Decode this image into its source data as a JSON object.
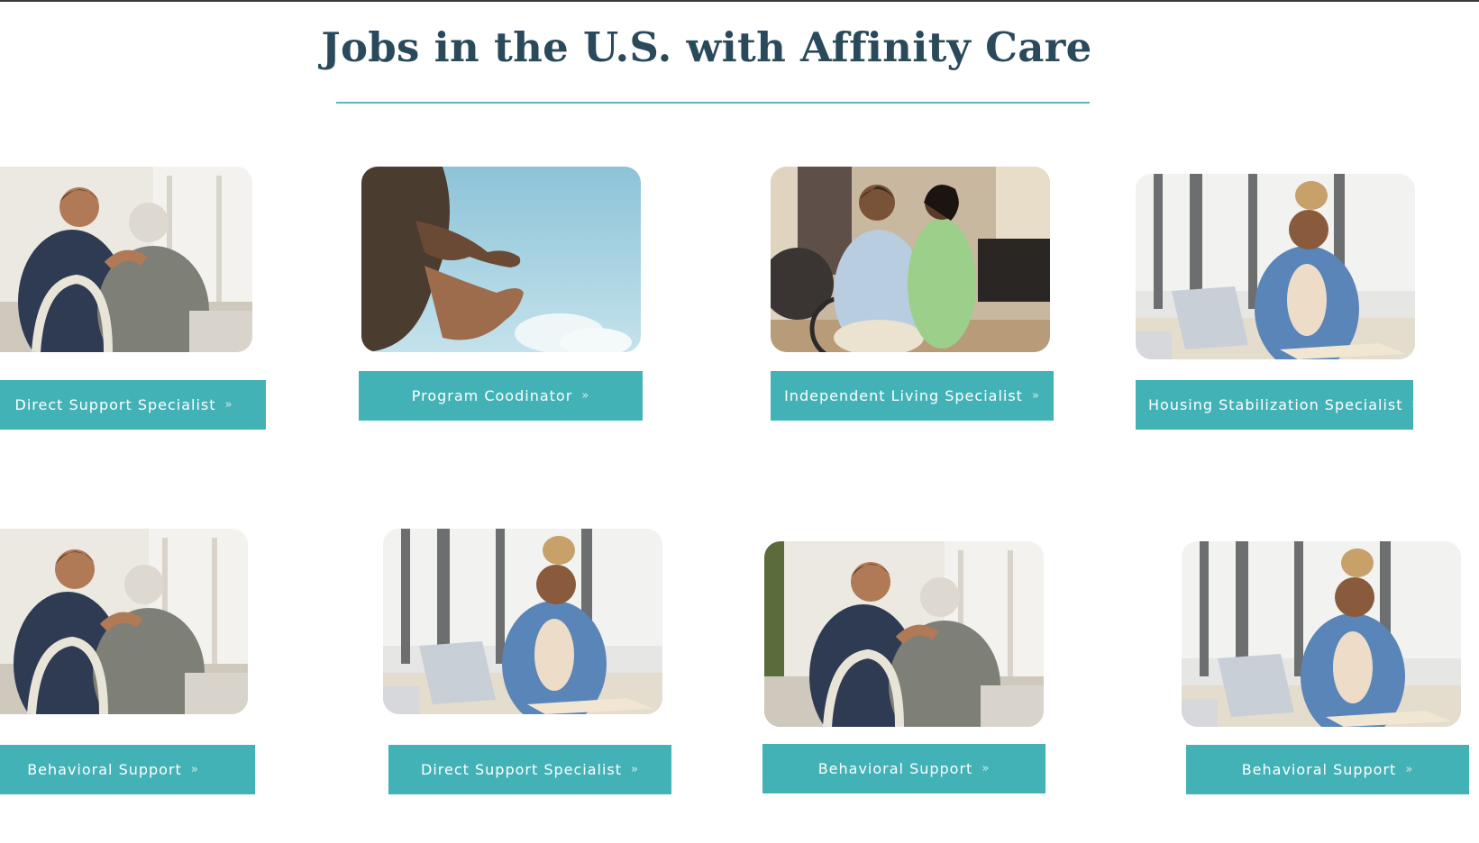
{
  "page": {
    "title": "Jobs in the U.S. with Affinity Care"
  },
  "colors": {
    "title": "#2a4a5c",
    "accent": "#43b2b7",
    "divider": "#5fb5bd"
  },
  "jobs": [
    {
      "label": "Direct Support Specialist",
      "chevron": "»",
      "photo": "caregiver-with-elderly-man-photo"
    },
    {
      "label": "Program Coodinator",
      "chevron": "»",
      "photo": "reaching-hands-sky-photo"
    },
    {
      "label": "Independent Living Specialist",
      "chevron": "»",
      "photo": "nurse-with-woman-in-wheelchair-photo"
    },
    {
      "label": "Housing Stabilization Specialist",
      "chevron": "»",
      "photo": "woman-studying-at-laptop-photo"
    },
    {
      "label": "Behavioral Support",
      "chevron": "»",
      "photo": "caregiver-with-elderly-man-photo"
    },
    {
      "label": "Direct Support Specialist",
      "chevron": "»",
      "photo": "woman-studying-at-laptop-photo"
    },
    {
      "label": "Behavioral Support",
      "chevron": "»",
      "photo": "caregiver-with-elderly-man-photo"
    },
    {
      "label": "Behavioral Support",
      "chevron": "»",
      "photo": "woman-studying-at-laptop-photo"
    }
  ]
}
